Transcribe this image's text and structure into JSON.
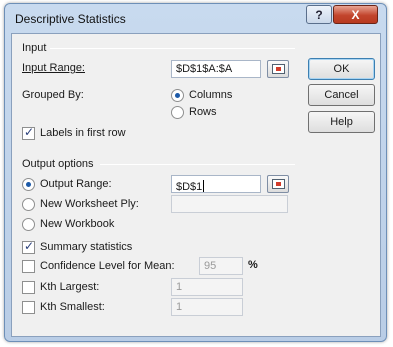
{
  "dialog": {
    "title": "Descriptive Statistics",
    "help_label": "?",
    "close_label": "X"
  },
  "input": {
    "group_label": "Input",
    "input_range_label": "Input Range:",
    "input_range_value": "$D$1$A:$A",
    "grouped_by_label": "Grouped By:",
    "columns_label": "Columns",
    "rows_label": "Rows",
    "grouped_by_selected": "Columns",
    "labels_first_row_label": "Labels in first row",
    "labels_first_row_checked": true
  },
  "buttons": {
    "ok": "OK",
    "cancel": "Cancel",
    "help": "Help"
  },
  "output": {
    "group_label": "Output options",
    "output_range_label": "Output Range:",
    "output_range_value": "$D$1",
    "new_worksheet_label": "New Worksheet Ply:",
    "new_worksheet_value": "",
    "new_workbook_label": "New Workbook",
    "selected": "Output Range",
    "summary_label": "Summary statistics",
    "summary_checked": true,
    "confidence_label": "Confidence Level for Mean:",
    "confidence_value": "95",
    "confidence_unit": "%",
    "kth_largest_label": "Kth Largest:",
    "kth_largest_value": "1",
    "kth_smallest_label": "Kth Smallest:",
    "kth_smallest_value": "1"
  },
  "colors": {
    "title_bar": "#c8daef",
    "close_button": "#c2452d",
    "dialog_background": "#f0f0f0"
  }
}
